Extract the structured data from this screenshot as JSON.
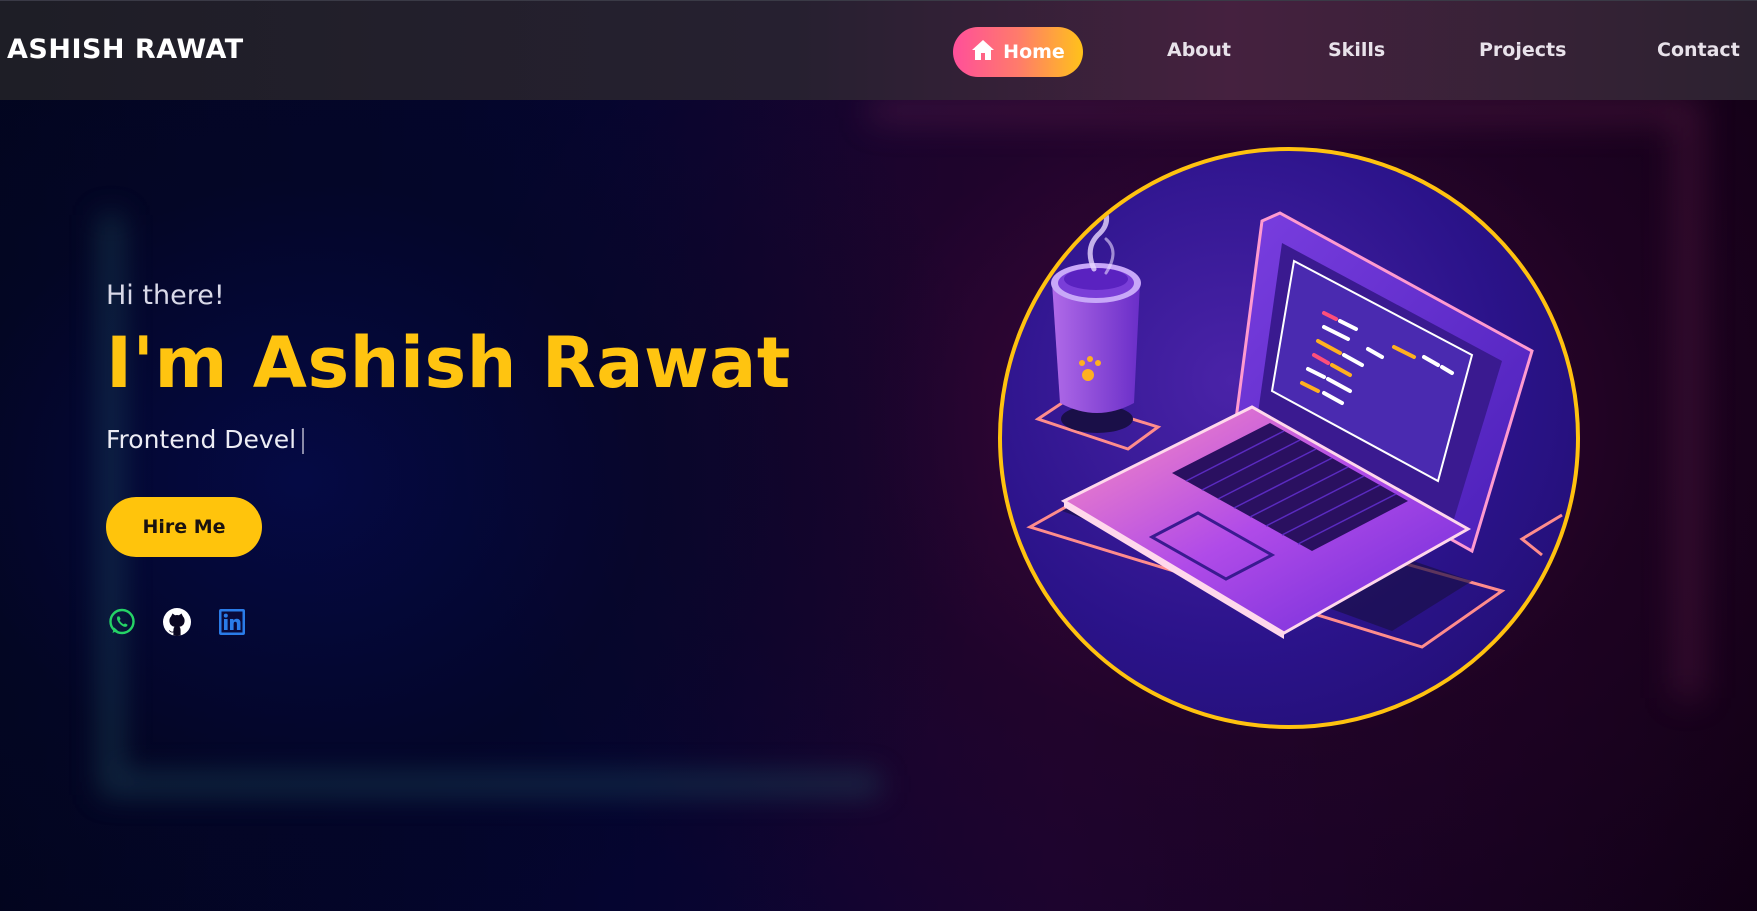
{
  "header": {
    "brand": "ASHISH RAWAT",
    "nav": [
      {
        "label": "Home",
        "icon": "home-icon",
        "active": true
      },
      {
        "label": "About"
      },
      {
        "label": "Skills"
      },
      {
        "label": "Projects"
      },
      {
        "label": "Contact"
      }
    ]
  },
  "hero": {
    "greeting": "Hi there!",
    "name": "I'm Ashish Rawat",
    "role": "Frontend Devel",
    "cta_label": "Hire Me",
    "social": [
      {
        "icon": "whatsapp-icon",
        "color": "#25d366"
      },
      {
        "icon": "github-icon",
        "color": "#ffffff"
      },
      {
        "icon": "linkedin-icon",
        "color": "#2a7ce8"
      }
    ],
    "image": {
      "subject": "laptop-illustration",
      "frame_color": "#ffc20f"
    }
  },
  "colors": {
    "accent": "#ffc40c",
    "home_gradient": [
      "#ff4f9a",
      "#ffc21a"
    ]
  }
}
